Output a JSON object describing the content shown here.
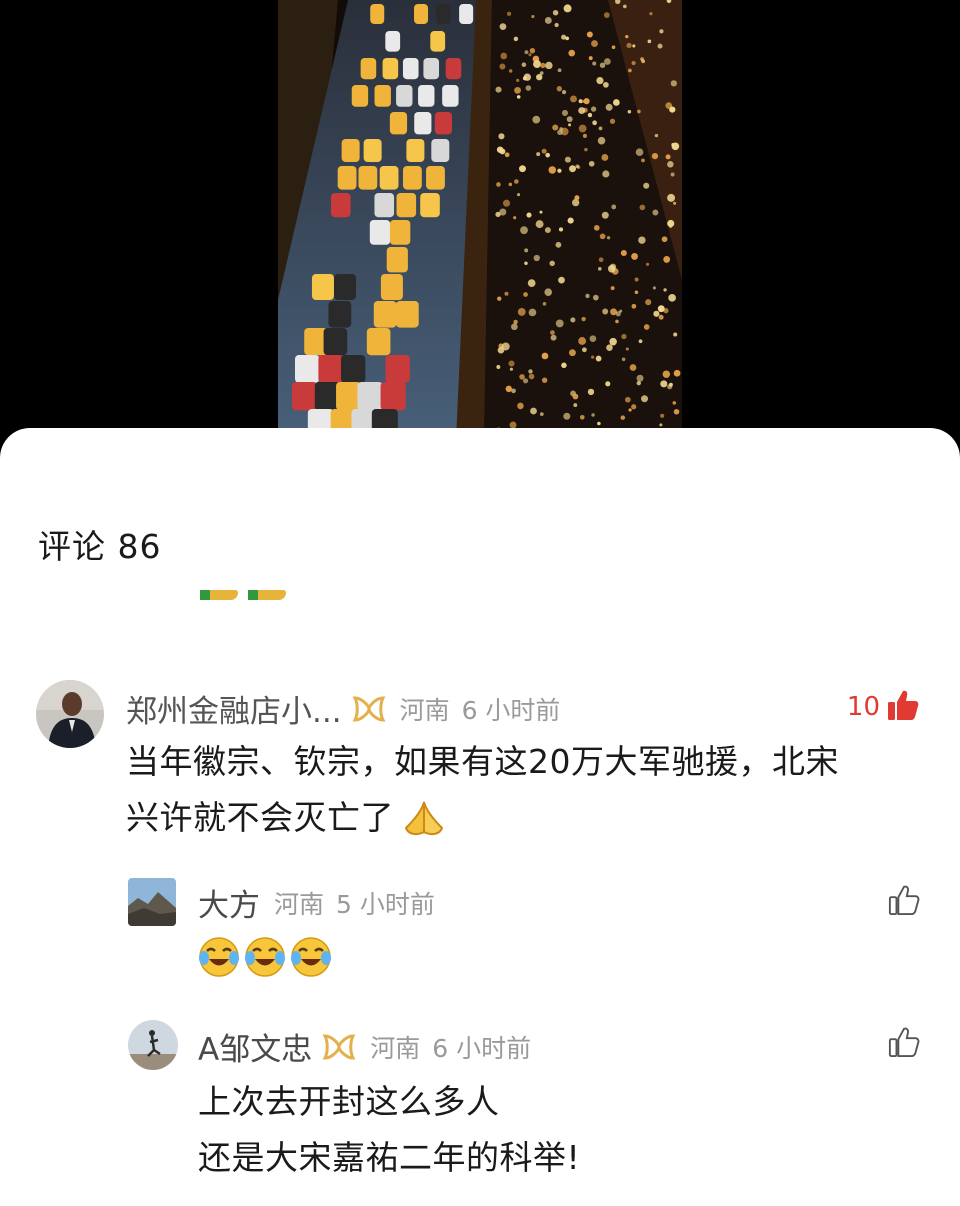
{
  "comments_header": {
    "label": "评论",
    "count": "86"
  },
  "comments": [
    {
      "username": "郑州金融店小...",
      "location": "河南",
      "time": "6 小时前",
      "likes": "10",
      "liked": true,
      "text_lines": [
        "当年徽宗、钦宗，如果有这20万大军驰援，北宋",
        "兴许就不会灭亡了"
      ],
      "emoji": "pray-icon",
      "replies": [
        {
          "username": "大方",
          "location": "河南",
          "time": "5 小时前",
          "emojis": [
            "laugh-cry-icon",
            "laugh-cry-icon",
            "laugh-cry-icon"
          ]
        },
        {
          "username": "A邹文忠",
          "location": "河南",
          "time": "6 小时前",
          "text_lines": [
            "上次去开封这么多人",
            "还是大宋嘉祐二年的科举!"
          ]
        }
      ]
    }
  ],
  "colors": {
    "like_red": "#e03a32",
    "badge_gold": "#e3b04b",
    "meta_gray": "#9a9a9a"
  }
}
